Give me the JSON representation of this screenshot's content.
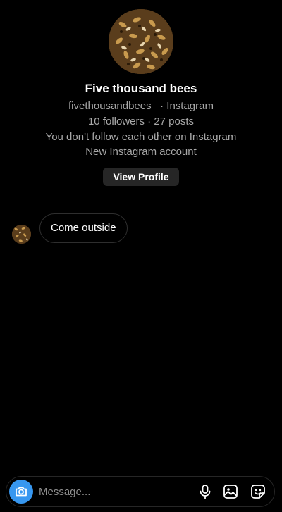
{
  "profile": {
    "display_name": "Five thousand bees",
    "handle_line": "fivethousandbees_ · Instagram",
    "stats_line": "10 followers · 27 posts",
    "follow_status": "You don't follow each other on Instagram",
    "account_note": "New Instagram account",
    "view_profile_label": "View Profile",
    "avatar_icon": "bees-avatar"
  },
  "messages": [
    {
      "sender": "fivethousandbees_",
      "text": "Come outside"
    }
  ],
  "composer": {
    "placeholder": "Message...",
    "icons": [
      "camera-icon",
      "microphone-icon",
      "gallery-icon",
      "sticker-icon"
    ]
  },
  "colors": {
    "background": "#000000",
    "accent": "#3797f0",
    "secondary_text": "#a8a8a8",
    "button_bg": "#262626"
  }
}
